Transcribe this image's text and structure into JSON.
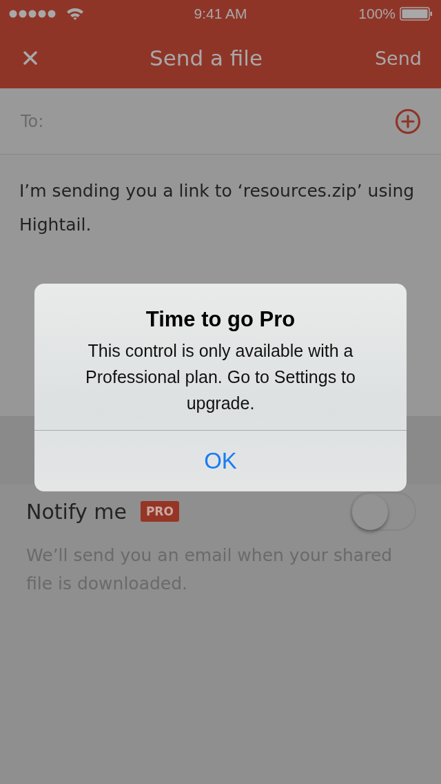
{
  "status_bar": {
    "time": "9:41 AM",
    "battery": "100%"
  },
  "nav": {
    "title": "Send a file",
    "action": "Send"
  },
  "to_field": {
    "label": "To:"
  },
  "message": "I’m sending you a link to ‘resources.zip’ using Hightail.",
  "notify": {
    "label": "Notify me",
    "badge": "PRO",
    "on": false,
    "description": "We’ll send you an email when your shared file is downloaded."
  },
  "alert": {
    "title": "Time to go Pro",
    "message": "This control is only available with a Professional plan. Go to Settings to upgrade.",
    "buttons": [
      "OK"
    ]
  }
}
